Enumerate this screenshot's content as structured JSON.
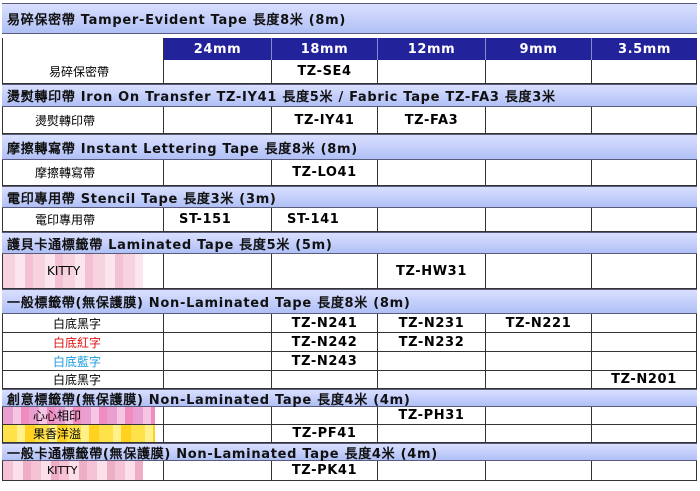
{
  "sections": {
    "tamper": {
      "title": "易碎保密帶  Tamper-Evident  Tape  長度8米  (8m)",
      "header_sizes": [
        "24mm",
        "18mm",
        "12mm",
        "9mm",
        "3.5mm"
      ],
      "rows": [
        {
          "label": "易碎保密帶",
          "cells": [
            "",
            "TZ-SE4",
            "",
            "",
            ""
          ]
        }
      ]
    },
    "iron": {
      "title": "燙熨轉印帶  Iron On Transfer  TZ-IY41  長度5米 / Fabric Tape  TZ-FA3  長度3米",
      "rows": [
        {
          "label": "燙熨轉印帶",
          "cells": [
            "",
            "TZ-IY41",
            "TZ-FA3",
            "",
            ""
          ]
        }
      ]
    },
    "instant": {
      "title": "摩擦轉寫帶  Instant Lettering  Tape  長度8米  (8m)",
      "rows": [
        {
          "label": "摩擦轉寫帶",
          "cells": [
            "",
            "TZ-LO41",
            "",
            "",
            ""
          ]
        }
      ]
    },
    "stencil": {
      "title": "電印專用帶  Stencil Tape  長度3米  (3m)",
      "rows": [
        {
          "label": "電印專用帶",
          "cells": [
            "ST-151",
            "ST-141",
            "",
            "",
            ""
          ]
        }
      ]
    },
    "laminated": {
      "title": "護貝卡通標籤帶  Laminated  Tape  長度5米  (5m)",
      "rows": [
        {
          "label": "KITTY",
          "cells": [
            "",
            "",
            "TZ-HW31",
            "",
            ""
          ]
        }
      ]
    },
    "nonlam": {
      "title": "一般標籤帶(無保護膜)  Non-Laminated  Tape  長度8米  (8m)",
      "rows": [
        {
          "label": "白底黑字",
          "cells": [
            "",
            "TZ-N241",
            "TZ-N231",
            "TZ-N221",
            ""
          ]
        },
        {
          "label": "白底紅字",
          "cells": [
            "",
            "TZ-N242",
            "TZ-N232",
            "",
            ""
          ]
        },
        {
          "label": "白底藍字",
          "cells": [
            "",
            "TZ-N243",
            "",
            "",
            ""
          ]
        },
        {
          "label": "白底黑字",
          "cells": [
            "",
            "",
            "",
            "",
            "TZ-N201"
          ]
        }
      ]
    },
    "creative": {
      "title": "創意標籤帶(無保護膜)  Non-Laminated  Tape  長度4米  (4m)",
      "rows": [
        {
          "label": "心心相印",
          "cells": [
            "",
            "",
            "TZ-PH31",
            "",
            ""
          ]
        },
        {
          "label": "果香洋溢",
          "cells": [
            "",
            "TZ-PF41",
            "",
            "",
            ""
          ]
        }
      ]
    },
    "cartoon": {
      "title": "一般卡通標籤帶(無保護膜)  Non-Laminated  Tape  長度4米  (4m)",
      "rows": [
        {
          "label": "KITTY",
          "cells": [
            "",
            "TZ-PK41",
            "",
            "",
            ""
          ]
        }
      ]
    }
  },
  "colors": {
    "band": "#b0c0f6",
    "header": "#22229a",
    "red_text": "#e01010",
    "blue_text": "#1a9ce0"
  }
}
